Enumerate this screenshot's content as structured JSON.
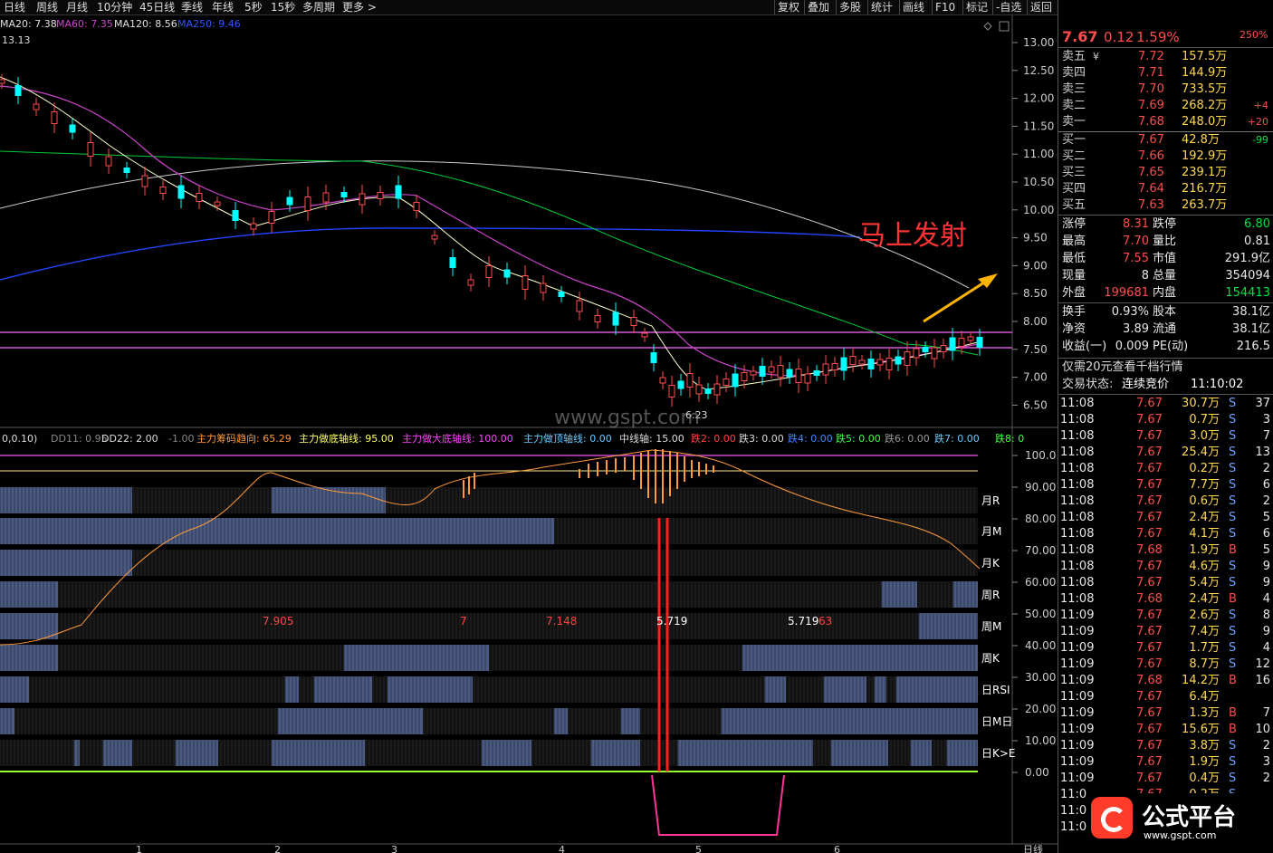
{
  "toolbar": {
    "periods": [
      "日线",
      "周线",
      "月线",
      "10分钟",
      "45日线",
      "季线",
      "年线",
      "5秒",
      "15秒",
      "多周期",
      "更多 >"
    ],
    "tools": [
      "复权",
      "叠加",
      "多股",
      "统计",
      "画线",
      "F10",
      "标记",
      "-自选",
      "返回"
    ]
  },
  "ma_legend": [
    {
      "text": "MA20: 7.38",
      "color": "#e0e0e0"
    },
    {
      "text": "MA60: 7.35",
      "color": "#cc44cc"
    },
    {
      "text": "MA120: 8.56",
      "color": "#e0e0e0"
    },
    {
      "text": "MA250: 9.46",
      "color": "#3355ff"
    }
  ],
  "price_high_label": "13.13",
  "price_low_label": "6.23",
  "annotation": "马上发射",
  "watermark": "www.gspt.com",
  "price_axis": [
    "13.00",
    "12.50",
    "12.00",
    "11.50",
    "11.00",
    "10.50",
    "10.00",
    "9.50",
    "9.00",
    "8.50",
    "8.00",
    "7.50",
    "7.00",
    "6.50"
  ],
  "ind_legend": [
    {
      "text": "0,0.10)",
      "color": "#dddddd"
    },
    {
      "text": "DD11: 0.95",
      "color": "#888888"
    },
    {
      "text": "DD22: 2.00",
      "color": "#dddddd"
    },
    {
      "text": "-1.00",
      "color": "#888888"
    },
    {
      "text": "主力筹码趋向: 65.29",
      "color": "#ff9a3c"
    },
    {
      "text": "主力做底轴线: 95.00",
      "color": "#ffff66"
    },
    {
      "text": "主力做大底轴线: 100.00",
      "color": "#ff44ff"
    },
    {
      "text": "主力做顶轴线: 0.00",
      "color": "#66ccff"
    },
    {
      "text": "中线轴: 15.00",
      "color": "#dddddd"
    },
    {
      "text": "跌2: 0.00",
      "color": "#ff4444"
    },
    {
      "text": "跌3: 0.00",
      "color": "#dddddd"
    },
    {
      "text": "跌4: 0.00",
      "color": "#4488ff"
    },
    {
      "text": "跌5: 0.00",
      "color": "#44ff44"
    },
    {
      "text": "跌6: 0.00",
      "color": "#999999"
    },
    {
      "text": "跌7: 0.00",
      "color": "#66ccff"
    },
    {
      "text": "跌8: 0",
      "color": "#44ff44"
    }
  ],
  "ind_axis": [
    "100.0",
    "90.00",
    "80.00",
    "70.00",
    "60.00",
    "50.00",
    "40.00",
    "30.00",
    "20.00",
    "10.00",
    "0.00"
  ],
  "row_labels": [
    "月R",
    "月M",
    "月K",
    "周R",
    "周M",
    "周K",
    "日RSI",
    "日M日",
    "日K>E"
  ],
  "ind_values": [
    {
      "text": "7.905",
      "color": "#ff4444"
    },
    {
      "text": "7",
      "color": "#ff4444"
    },
    {
      "text": "7.148",
      "color": "#ff4444"
    },
    {
      "text": "5.719",
      "color": "#ffffff"
    },
    {
      "text": "5.719",
      "color": "#ffffff"
    },
    {
      "text": "63",
      "color": "#ff4444"
    }
  ],
  "x_axis": [
    "1",
    "2",
    "3",
    "4",
    "5",
    "6"
  ],
  "bottom_tab": "日线",
  "quote": {
    "price": "7.67",
    "change": "0.12",
    "pct": "1.59%",
    "top_right": "250%",
    "asks": [
      {
        "label": "卖五",
        "flag": "¥",
        "price": "7.72",
        "vol": "157.5万",
        "delta": ""
      },
      {
        "label": "卖四",
        "flag": "",
        "price": "7.71",
        "vol": "144.9万",
        "delta": ""
      },
      {
        "label": "卖三",
        "flag": "",
        "price": "7.70",
        "vol": "733.5万",
        "delta": ""
      },
      {
        "label": "卖二",
        "flag": "",
        "price": "7.69",
        "vol": "268.2万",
        "delta": "+4"
      },
      {
        "label": "卖一",
        "flag": "",
        "price": "7.68",
        "vol": "248.0万",
        "delta": "+20"
      }
    ],
    "bids": [
      {
        "label": "买一",
        "price": "7.67",
        "vol": "42.8万",
        "delta": "-99"
      },
      {
        "label": "买二",
        "price": "7.66",
        "vol": "192.9万",
        "delta": ""
      },
      {
        "label": "买三",
        "price": "7.65",
        "vol": "239.1万",
        "delta": ""
      },
      {
        "label": "买四",
        "price": "7.64",
        "vol": "216.7万",
        "delta": ""
      },
      {
        "label": "买五",
        "price": "7.63",
        "vol": "263.7万",
        "delta": ""
      }
    ],
    "stats": [
      {
        "l1": "涨停",
        "v1": "8.31",
        "l2": "跌停",
        "v2": "6.80"
      },
      {
        "l1": "最高",
        "v1": "7.70",
        "l2": "量比",
        "v2": "0.81"
      },
      {
        "l1": "最低",
        "v1": "7.55",
        "l2": "市值",
        "v2": "291.9亿"
      },
      {
        "l1": "现量",
        "v1": "8",
        "l2": "总量",
        "v2": "354094"
      },
      {
        "l1": "外盘",
        "v1": "199681",
        "l2": "内盘",
        "v2": "154413"
      }
    ],
    "stats2": [
      {
        "l1": "换手",
        "v1": "0.93%",
        "l2": "股本",
        "v2": "38.1亿"
      },
      {
        "l1": "净资",
        "v1": "3.89",
        "l2": "流通",
        "v2": "38.1亿"
      },
      {
        "l1": "收益(一)",
        "v1": "0.009",
        "l2": "PE(动)",
        "v2": "216.5"
      }
    ],
    "promo": "仅需20元查看千档行情",
    "trade_state_label": "交易状态:",
    "trade_state": "连续竞价",
    "trade_time": "11:10:02"
  },
  "ticks": [
    [
      "11:08",
      "7.67",
      "30.7万",
      "S",
      "37"
    ],
    [
      "11:08",
      "7.67",
      "0.7万",
      "S",
      "3"
    ],
    [
      "11:08",
      "7.67",
      "3.0万",
      "S",
      "7"
    ],
    [
      "11:08",
      "7.67",
      "25.4万",
      "S",
      "13"
    ],
    [
      "11:08",
      "7.67",
      "0.2万",
      "S",
      "2"
    ],
    [
      "11:08",
      "7.67",
      "7.7万",
      "S",
      "6"
    ],
    [
      "11:08",
      "7.67",
      "0.6万",
      "S",
      "2"
    ],
    [
      "11:08",
      "7.67",
      "2.4万",
      "S",
      "5"
    ],
    [
      "11:08",
      "7.67",
      "4.1万",
      "S",
      "6"
    ],
    [
      "11:08",
      "7.68",
      "1.9万",
      "B",
      "5"
    ],
    [
      "11:08",
      "7.67",
      "4.6万",
      "S",
      "9"
    ],
    [
      "11:08",
      "7.67",
      "5.4万",
      "S",
      "9"
    ],
    [
      "11:08",
      "7.68",
      "2.4万",
      "B",
      "4"
    ],
    [
      "11:09",
      "7.67",
      "2.6万",
      "S",
      "8"
    ],
    [
      "11:09",
      "7.67",
      "7.4万",
      "S",
      "9"
    ],
    [
      "11:09",
      "7.67",
      "1.7万",
      "S",
      "4"
    ],
    [
      "11:09",
      "7.67",
      "8.7万",
      "S",
      "12"
    ],
    [
      "11:09",
      "7.68",
      "14.2万",
      "B",
      "16"
    ],
    [
      "11:09",
      "7.67",
      "6.4万",
      "",
      ""
    ],
    [
      "11:09",
      "7.67",
      "1.3万",
      "B",
      "7"
    ],
    [
      "11:09",
      "7.67",
      "15.6万",
      "B",
      "10"
    ],
    [
      "11:09",
      "7.67",
      "3.8万",
      "S",
      "2"
    ],
    [
      "11:09",
      "7.67",
      "1.9万",
      "S",
      "3"
    ],
    [
      "11:09",
      "7.67",
      "0.4万",
      "S",
      "2"
    ],
    [
      "11:0",
      "7.67",
      "0.2万",
      "S",
      ""
    ],
    [
      "11:0",
      "",
      "",
      "",
      ""
    ],
    [
      "11:0",
      "",
      "",
      "",
      ""
    ]
  ],
  "logo": {
    "text": "公式平台",
    "url": "www.gspt.com"
  },
  "colors": {
    "up": "#ff4d4d",
    "down": "#00ffff",
    "ma20": "#ffffff",
    "ma60": "#cc44cc",
    "ma120": "#00cc33",
    "ma250": "#2244ff",
    "bar": "#4a5a80"
  }
}
